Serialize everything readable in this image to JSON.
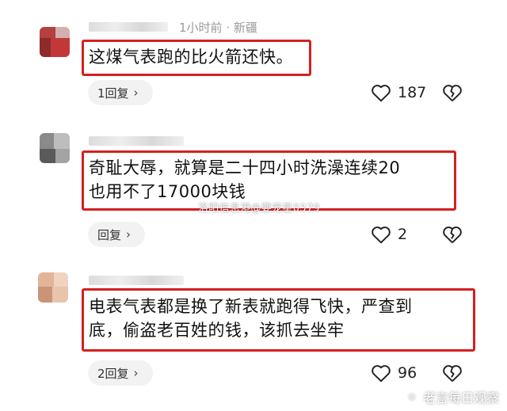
{
  "comments": [
    {
      "meta": "1小时前 · 新疆",
      "text_lines": [
        "这煤气表跑的比火箭还快。"
      ],
      "reply_label": "1回复",
      "likes": "187"
    },
    {
      "meta": "",
      "text_lines": [
        "奇耻大辱，就算是二十四小时洗澡连续20",
        "也用不了17000块钱"
      ],
      "reply_label": "回复",
      "likes": "2"
    },
    {
      "meta": "",
      "text_lines": [
        "电表气表都是换了新表就跑得飞快，严查到",
        "底，偷盗老百姓的钱，该抓去坐牢"
      ],
      "reply_label": "2回复",
      "likes": "96"
    }
  ],
  "watermark": "洛阳信息港@要宠星0379",
  "brand": "老言每日观察",
  "colors": {
    "highlight": "#d42020",
    "pill_bg": "#f2f2f2",
    "meta": "#9a9a9a"
  }
}
